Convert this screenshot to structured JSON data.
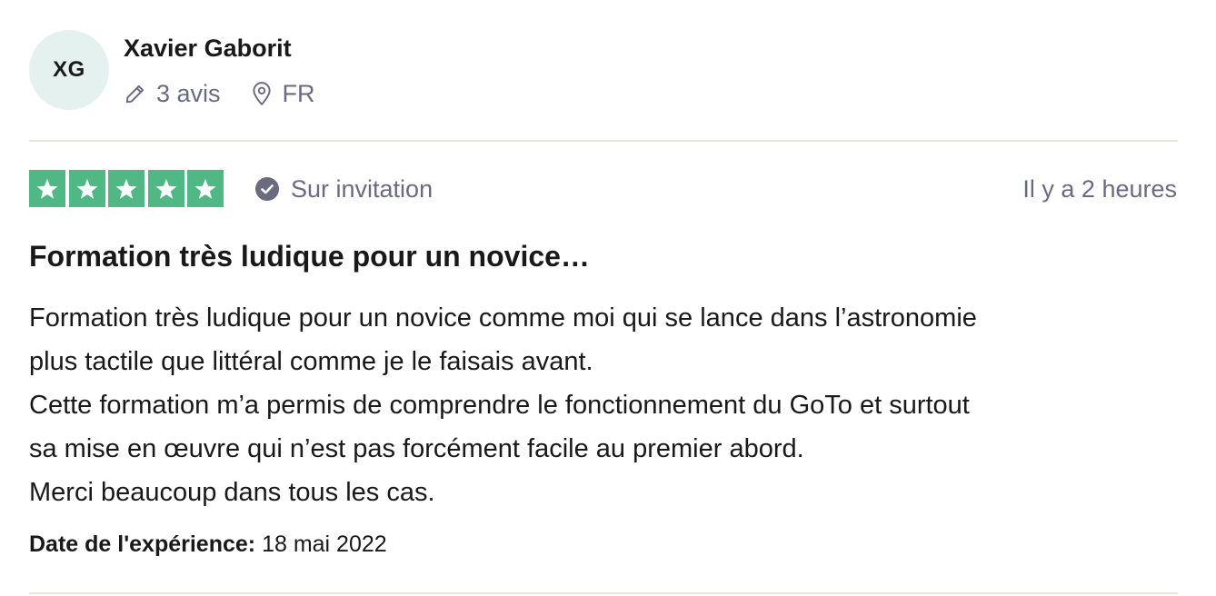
{
  "consumer": {
    "initials": "XG",
    "name": "Xavier Gaborit",
    "reviews_count": "3 avis",
    "country": "FR"
  },
  "review": {
    "rating": 5,
    "star_color": "#4fb884",
    "verification_label": "Sur invitation",
    "date_posted": "Il y a 2 heures",
    "title": "Formation très ludique pour un novice…",
    "body_lines": [
      "Formation très ludique pour un novice comme moi qui se lance dans l’astronomie",
      "plus tactile que littéral comme je le faisais avant.",
      "Cette formation m’a permis de comprendre le fonctionnement du GoTo et surtout",
      "sa mise en œuvre qui n’est pas forcément facile au premier abord.",
      "Merci beaucoup dans tous les cas."
    ],
    "experience_label": "Date de l'expérience:",
    "experience_date": "18 mai 2022"
  },
  "icons": {
    "reviews": "pencil-icon",
    "location": "location-pin-icon",
    "verification": "check-circle-icon",
    "rating": "star-icon"
  },
  "colors": {
    "avatar_bg": "#e5f1ef",
    "muted_text": "#6b6b80",
    "divider": "#e5e5dd"
  }
}
